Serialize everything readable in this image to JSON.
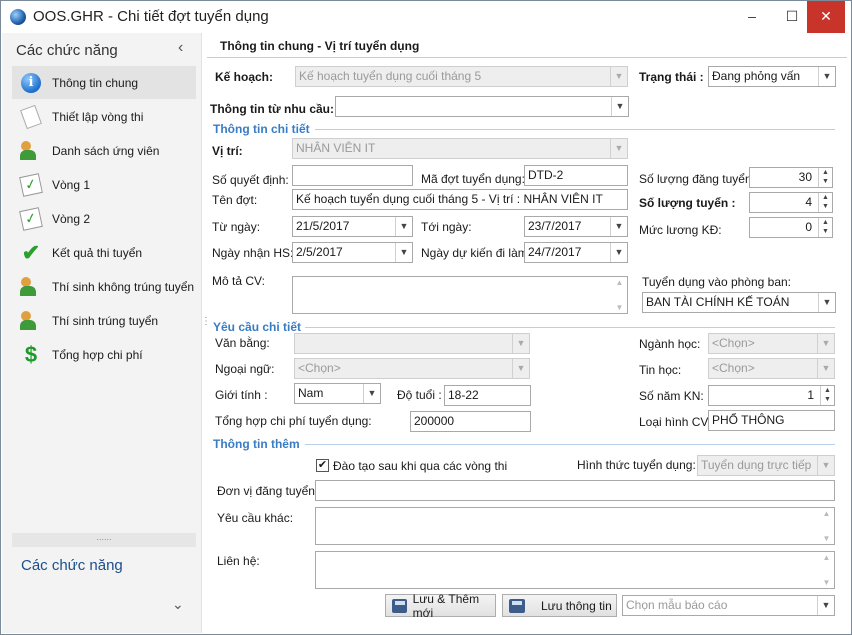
{
  "window": {
    "title": "OOS.GHR - Chi tiết đợt tuyển dụng",
    "minimize": "–",
    "maximize": "☐",
    "close": "✕"
  },
  "sidebar": {
    "title": "Các chức năng",
    "collapse": "‹",
    "items": [
      {
        "label": "Thông tin chung",
        "icon": "info-icon"
      },
      {
        "label": "Thiết lập vòng thi",
        "icon": "paper-icon"
      },
      {
        "label": "Danh sách ứng viên",
        "icon": "people-icon"
      },
      {
        "label": "Vòng 1",
        "icon": "round-icon"
      },
      {
        "label": "Vòng 2",
        "icon": "round-icon"
      },
      {
        "label": "Kết quả thi tuyển",
        "icon": "check-icon"
      },
      {
        "label": "Thí sinh không trúng tuyển",
        "icon": "people-icon"
      },
      {
        "label": "Thí sinh trúng tuyển",
        "icon": "people-icon"
      },
      {
        "label": "Tổng hợp chi phí",
        "icon": "dollar-icon"
      }
    ],
    "bottom_title": "Các chức năng",
    "grip": "......",
    "down": "⌄",
    "splitter": "⋮"
  },
  "form": {
    "header": "Thông tin chung - Vị trí tuyển dụng",
    "ke_hoach_label": "Kế hoạch:",
    "ke_hoach_value": "Kế hoạch tuyển dụng  cuối tháng 5",
    "trang_thai_label": "Trạng thái :",
    "trang_thai_value": "Đang phỏng vấn",
    "tt_nhu_cau_label": "Thông tin từ nhu cầu:",
    "tt_nhu_cau_value": "",
    "sec_chi_tiet": "Thông tin chi tiết",
    "vi_tri_label": "Vị trí:",
    "vi_tri_value": "NHÂN VIÊN IT",
    "so_qd_label": "Số quyết định:",
    "so_qd_value": "",
    "ma_dot_label": "Mã đợt tuyển dụng:",
    "ma_dot_value": "DTD-2",
    "so_luong_dk_label": "Số lượng đăng tuyển:",
    "so_luong_dk_value": "30",
    "ten_dot_label": "Tên đợt:",
    "ten_dot_value": "Kế hoạch tuyển dụng  cuối tháng 5 - Vị trí : NHÂN VIÊN IT",
    "so_luong_tuyen_label": "Số lượng tuyển :",
    "so_luong_tuyen_value": "4",
    "tu_ngay_label": "Từ ngày:",
    "tu_ngay_value": "21/5/2017",
    "toi_ngay_label": "Tới ngày:",
    "toi_ngay_value": "23/7/2017",
    "muc_luong_label": "Mức lương KĐ:",
    "muc_luong_value": "0",
    "ngay_nhan_label": "Ngày nhận HS:",
    "ngay_nhan_value": "2/5/2017",
    "ngay_di_lam_label": "Ngày dự kiến đi làm:",
    "ngay_di_lam_value": "24/7/2017",
    "mo_ta_label": "Mô tả CV:",
    "phong_ban_label": "Tuyển dụng vào phòng ban:",
    "phong_ban_value": "BAN TÀI CHÍNH KẾ TOÁN",
    "sec_yeu_cau": "Yêu cầu chi tiết",
    "van_bang_label": "Văn bằng:",
    "van_bang_value": "",
    "nganh_hoc_label": "Ngành học:",
    "nganh_hoc_value": "<Chọn>",
    "ngoai_ngu_label": "Ngoại ngữ:",
    "ngoai_ngu_value": "<Chọn>",
    "tin_hoc_label": "Tin học:",
    "tin_hoc_value": "<Chọn>",
    "gioi_tinh_label": "Giới tính :",
    "gioi_tinh_value": "Nam",
    "do_tuoi_label": "Độ tuổi :",
    "do_tuoi_value": "18-22",
    "so_nam_kn_label": "Số năm KN:",
    "so_nam_kn_value": "1",
    "tong_chi_phi_label": "Tổng hợp chi phí tuyển dụng:",
    "tong_chi_phi_value": "200000",
    "loai_hinh_label": "Loại hình CV:",
    "loai_hinh_value": "PHỔ THÔNG",
    "sec_them": "Thông tin thêm",
    "dao_tao_label": "Đào tạo sau khi qua các vòng thi",
    "dao_tao_checked": "✔",
    "hinh_thuc_label": "Hình thức tuyển dụng:",
    "hinh_thuc_value": "Tuyển dụng trực tiếp",
    "don_vi_label": "Đơn vị đăng tuyển:",
    "yeu_cau_khac_label": "Yêu cầu khác:",
    "lien_he_label": "Liên hệ:",
    "btn_luu_them": "Lưu & Thêm mới",
    "btn_luu": "Lưu thông tin",
    "mau_bao_cao_placeholder": "Chọn mẫu báo cáo",
    "dd_arrow": "▼",
    "spin_up": "▲",
    "spin_down": "▼",
    "scroll_up": "▲",
    "scroll_down": "▼"
  }
}
